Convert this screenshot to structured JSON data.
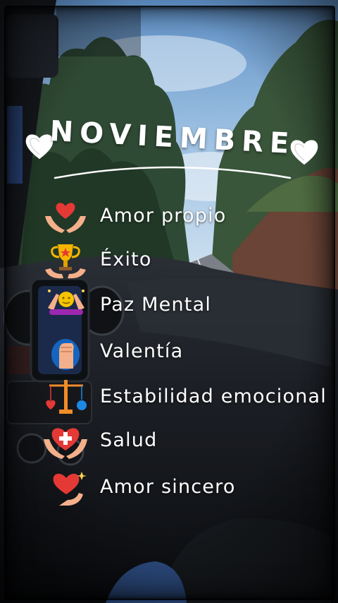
{
  "title": "NOVIEMBRE",
  "items": [
    {
      "label": "Amor propio",
      "icon": "heart-in-hands-icon"
    },
    {
      "label": "Éxito",
      "icon": "trophy-icon"
    },
    {
      "label": "Paz Mental",
      "icon": "meditation-icon"
    },
    {
      "label": "Valentía",
      "icon": "raised-fist-icon"
    },
    {
      "label": "Estabilidad emocional",
      "icon": "balance-scale-icon"
    },
    {
      "label": "Salud",
      "icon": "health-heart-icon"
    },
    {
      "label": "Amor sincero",
      "icon": "sparkling-heart-icon"
    }
  ],
  "colors": {
    "text": "#ffffff",
    "heart": "#e53935",
    "sky": "#8fb6dc",
    "dashboard": "#1b1e24"
  }
}
